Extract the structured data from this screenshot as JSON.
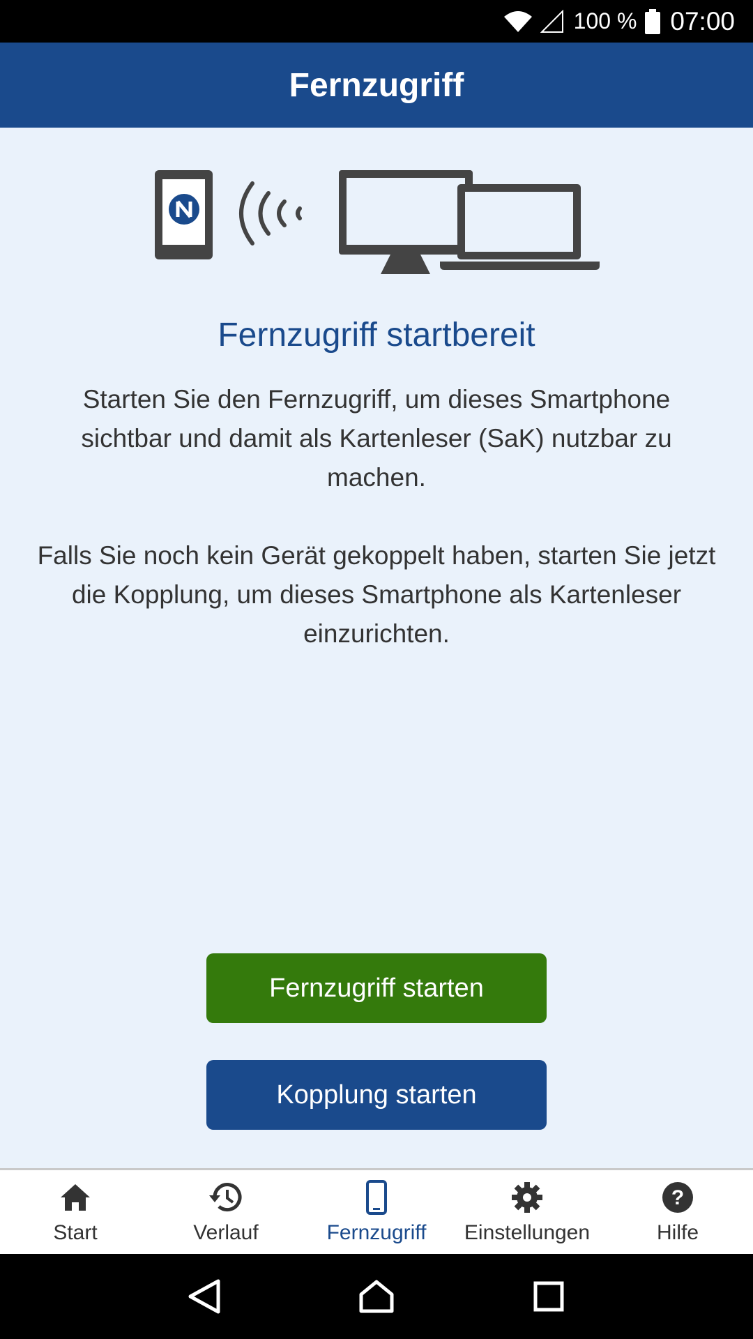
{
  "status_bar": {
    "battery_percent": "100 %",
    "time": "07:00"
  },
  "app_bar": {
    "title": "Fernzugriff"
  },
  "main": {
    "heading": "Fernzugriff startbereit",
    "paragraph1": "Starten Sie den Fernzugriff, um dieses Smartphone sichtbar und damit als Kartenleser (SaK) nutzbar zu machen.",
    "paragraph2": "Falls Sie noch kein Gerät gekoppelt haben, starten Sie jetzt die Kopplung, um dieses Smartphone als Kartenleser einzurichten.",
    "illustration_icons": [
      "smartphone-nfc-icon",
      "nfc-waves-icon",
      "desktop-monitor-icon",
      "laptop-icon"
    ]
  },
  "buttons": {
    "start_remote_access": "Fernzugriff starten",
    "start_pairing": "Kopplung starten"
  },
  "bottom_nav": {
    "items": [
      {
        "label": "Start",
        "icon": "home-icon"
      },
      {
        "label": "Verlauf",
        "icon": "history-icon"
      },
      {
        "label": "Fernzugriff",
        "icon": "smartphone-icon",
        "active": true
      },
      {
        "label": "Einstellungen",
        "icon": "gear-icon"
      },
      {
        "label": "Hilfe",
        "icon": "help-icon"
      }
    ]
  },
  "system_nav": {
    "icons": [
      "back-icon",
      "home-icon",
      "recents-icon"
    ]
  },
  "colors": {
    "primary_blue": "#1a4a8c",
    "accent_green": "#347a0c",
    "background": "#eaf2fb"
  }
}
